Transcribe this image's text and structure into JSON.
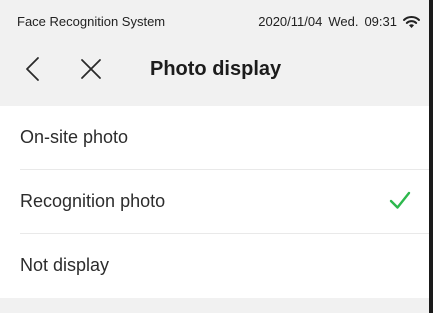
{
  "status_bar": {
    "app_name": "Face Recognition System",
    "date": "2020/11/04",
    "day": "Wed.",
    "time": "09:31",
    "wifi_icon": "wifi-icon"
  },
  "nav": {
    "back_icon": "chevron-left-icon",
    "close_icon": "close-icon",
    "title": "Photo display"
  },
  "options": [
    {
      "label": "On-site photo",
      "selected": false
    },
    {
      "label": "Recognition photo",
      "selected": true
    },
    {
      "label": "Not display",
      "selected": false
    }
  ],
  "colors": {
    "header_bg": "#f1f1f1",
    "check_color": "#2db84d",
    "text": "#2c2c2c"
  }
}
